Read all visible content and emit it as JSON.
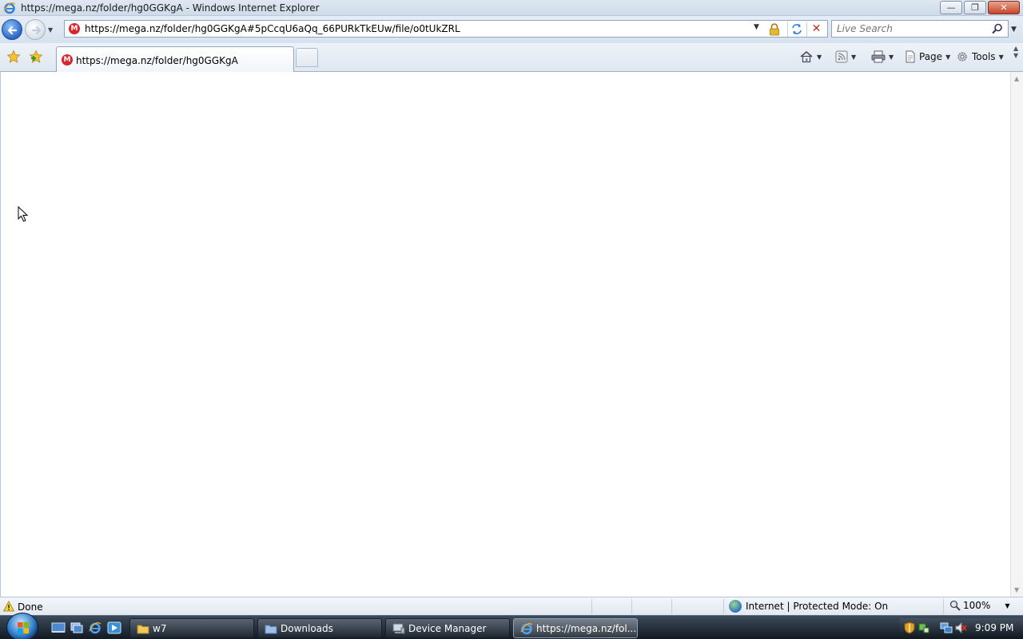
{
  "window": {
    "title": "https://mega.nz/folder/hg0GGKgA - Windows Internet Explorer",
    "minimize_label": "—",
    "maximize_label": "❐",
    "close_label": "✕"
  },
  "address_bar": {
    "url": "https://mega.nz/folder/hg0GGKgA#5pCcqU6aQq_66PURkTkEUw/file/o0tUkZRL",
    "favicon_letter": "M"
  },
  "search": {
    "placeholder": "Live Search"
  },
  "tabs": [
    {
      "title": "https://mega.nz/folder/hg0GGKgA",
      "favicon_letter": "M",
      "active": true
    }
  ],
  "command_bar": {
    "page_label": "Page",
    "tools_label": "Tools"
  },
  "status_bar": {
    "status_text": "Done",
    "zone_text": "Internet | Protected Mode: On",
    "zoom_text": "100%"
  },
  "taskbar": {
    "buttons": [
      {
        "label": "w7",
        "icon": "folder-icon",
        "active": false
      },
      {
        "label": "Downloads",
        "icon": "folder-icon",
        "active": false
      },
      {
        "label": "Device Manager",
        "icon": "device-manager-icon",
        "active": false
      },
      {
        "label": "https://mega.nz/fol...",
        "icon": "ie-icon",
        "active": true
      }
    ],
    "clock": "9:09 PM"
  },
  "colors": {
    "mega_red": "#d9262c",
    "ie_blue": "#2b66c4",
    "stop_red": "#c5291d"
  }
}
